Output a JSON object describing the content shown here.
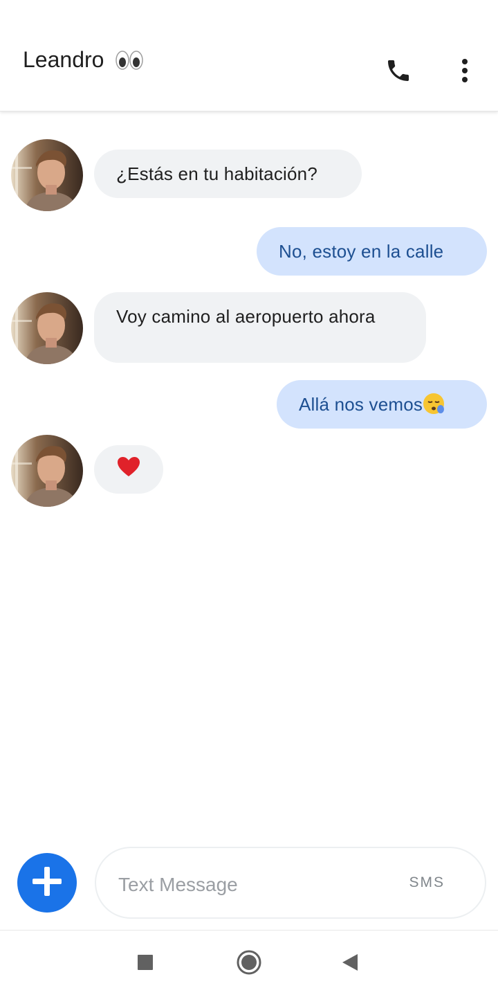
{
  "header": {
    "contact_name": "Leandro",
    "title_emoji_icon": "eyes-emoji",
    "call_icon": "phone-icon",
    "menu_icon": "more-vert-icon"
  },
  "messages": [
    {
      "direction": "incoming",
      "text": "¿Estás en tu habitación?"
    },
    {
      "direction": "outgoing",
      "text": "No, estoy en la calle"
    },
    {
      "direction": "incoming",
      "text": "Voy camino al aeropuerto ahora"
    },
    {
      "direction": "outgoing",
      "text": "Allá nos vemos",
      "emoji_icon": "sleepy-face-emoji"
    },
    {
      "direction": "incoming",
      "text": "",
      "emoji_icon": "red-heart-emoji"
    }
  ],
  "composer": {
    "placeholder": "Text Message",
    "value": "",
    "mode_label": "SMS",
    "add_icon": "plus-icon"
  },
  "navbar": {
    "recent_icon": "square-icon",
    "home_icon": "circle-icon",
    "back_icon": "triangle-back-icon"
  },
  "colors": {
    "incoming_bubble": "#f0f2f4",
    "outgoing_bubble": "#d3e3fd",
    "outgoing_text": "#1d4f91",
    "accent": "#1a73e8"
  }
}
